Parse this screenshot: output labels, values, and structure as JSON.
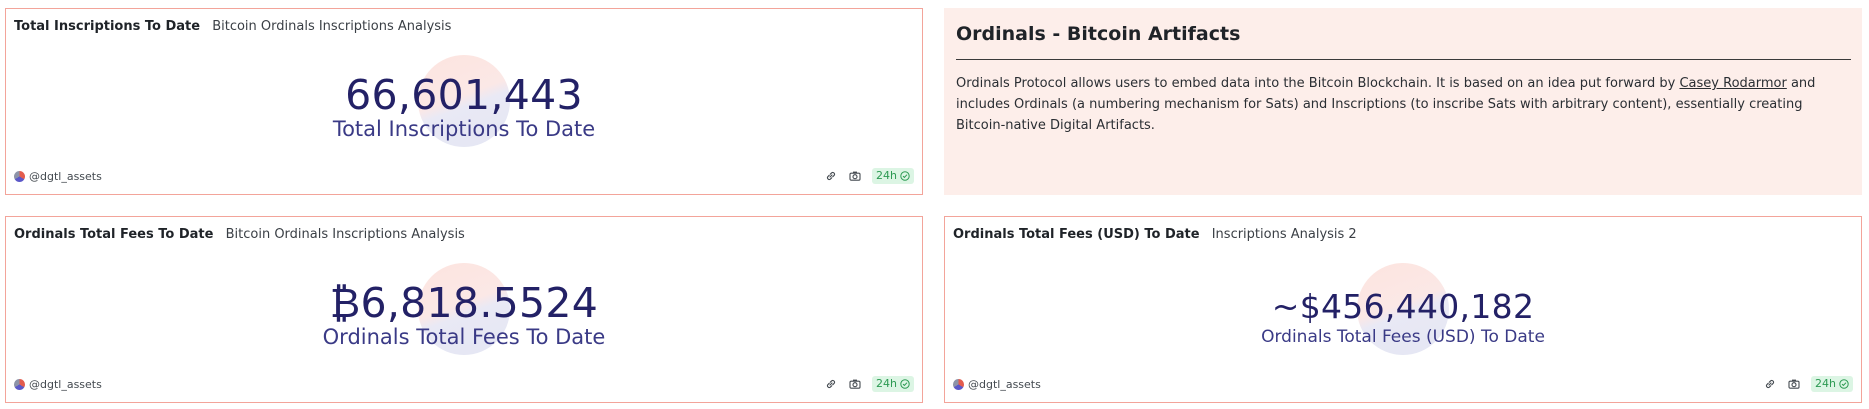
{
  "panels": {
    "inscriptions": {
      "title": "Total Inscriptions To Date",
      "subtitle": "Bitcoin Ordinals Inscriptions Analysis",
      "value": "66,601,443",
      "label": "Total Inscriptions To Date",
      "author": "@dgtl_assets",
      "refresh": "24h"
    },
    "fees_btc": {
      "title": "Ordinals Total Fees To Date",
      "subtitle": "Bitcoin Ordinals Inscriptions Analysis",
      "value": "₿6,818.5524",
      "label": "Ordinals Total Fees To Date",
      "author": "@dgtl_assets",
      "refresh": "24h"
    },
    "fees_usd": {
      "title": "Ordinals Total Fees (USD) To Date",
      "subtitle": "Inscriptions Analysis 2",
      "value": "~$456,440,182",
      "label": "Ordinals Total Fees (USD) To Date",
      "author": "@dgtl_assets",
      "refresh": "24h"
    }
  },
  "text_panel": {
    "title": "Ordinals - Bitcoin Artifacts",
    "body_before_link": "Ordinals Protocol allows users to embed data into the Bitcoin Blockchain. It is based on an idea put forward by ",
    "link_text": "Casey Rodarmor",
    "body_after_link": " and includes Ordinals (a numbering mechanism for Sats) and Inscriptions (to inscribe Sats with arbitrary content), essentially creating Bitcoin-native Digital Artifacts."
  },
  "icons": {
    "link": "link-icon",
    "camera": "camera-icon",
    "check": "check-circle-icon",
    "avatar": "avatar"
  },
  "colors": {
    "panel_border": "#f3a49a",
    "text_panel_bg": "#fdeeea",
    "counter_value": "#232166",
    "badge_bg": "#dcf5e4",
    "badge_text": "#2c9a52"
  }
}
